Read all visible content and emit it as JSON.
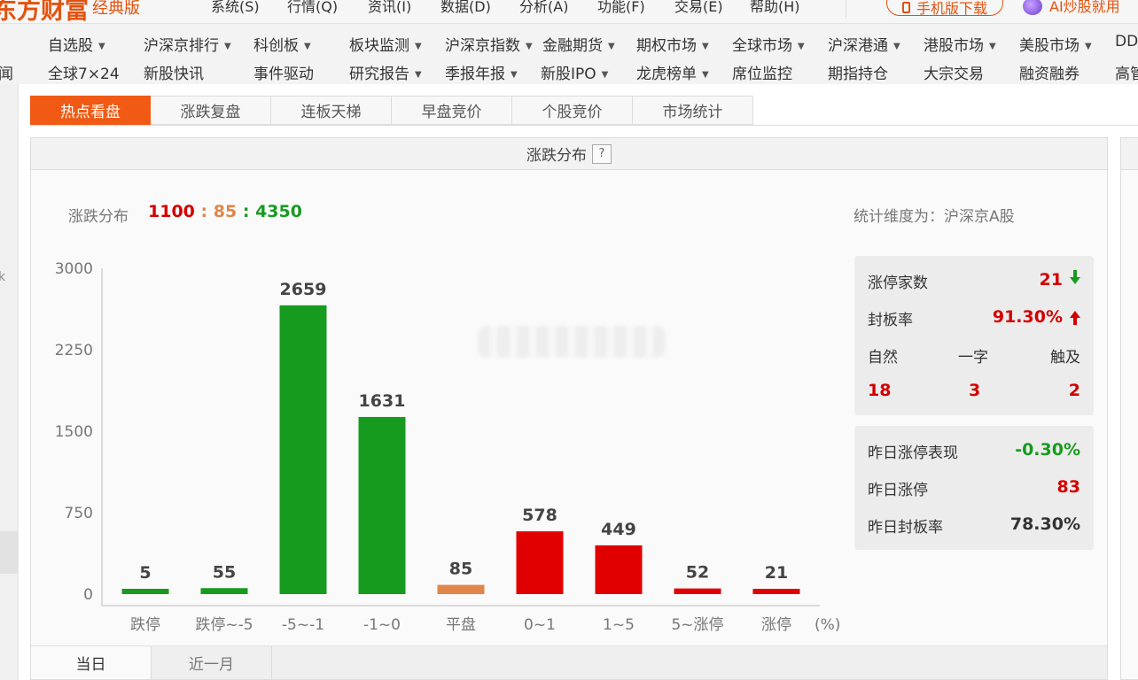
{
  "app": {
    "logo_text": "东方财富",
    "logo_sub": "经典版"
  },
  "menu": {
    "items": [
      "系统(S)",
      "行情(Q)",
      "资讯(I)",
      "数据(D)",
      "分析(A)",
      "功能(F)",
      "交易(E)",
      "帮助(H)"
    ],
    "mobile_download": "手机版下载",
    "ai_stock": "AI炒股就用"
  },
  "nav": {
    "row1": [
      {
        "label": "自选股",
        "dropdown": true
      },
      {
        "label": "沪深京排行",
        "dropdown": true
      },
      {
        "label": "科创板",
        "dropdown": true
      },
      {
        "label": "板块监测",
        "dropdown": true
      },
      {
        "label": "沪深京指数",
        "dropdown": true
      },
      {
        "label": "金融期货",
        "dropdown": true
      },
      {
        "label": "期权市场",
        "dropdown": true
      },
      {
        "label": "全球市场",
        "dropdown": true
      },
      {
        "label": "沪深港通",
        "dropdown": true
      },
      {
        "label": "港股市场",
        "dropdown": true
      },
      {
        "label": "美股市场",
        "dropdown": true
      },
      {
        "label": "DD",
        "dropdown": false
      }
    ],
    "row2": [
      {
        "label": "闻",
        "dropdown": false
      },
      {
        "label": "全球7×24",
        "dropdown": false
      },
      {
        "label": "新股快讯",
        "dropdown": false
      },
      {
        "label": "事件驱动",
        "dropdown": false
      },
      {
        "label": "研究报告",
        "dropdown": true
      },
      {
        "label": "季报年报",
        "dropdown": true
      },
      {
        "label": "新股IPO",
        "dropdown": true
      },
      {
        "label": "龙虎榜单",
        "dropdown": true
      },
      {
        "label": "席位监控",
        "dropdown": false
      },
      {
        "label": "期指持仓",
        "dropdown": false
      },
      {
        "label": "大宗交易",
        "dropdown": false
      },
      {
        "label": "融资融券",
        "dropdown": false
      },
      {
        "label": "高管",
        "dropdown": false
      }
    ]
  },
  "sidebar_mark": "k",
  "subtabs": [
    "热点看盘",
    "涨跌复盘",
    "连板天梯",
    "早盘竞价",
    "个股竞价",
    "市场统计"
  ],
  "panel": {
    "title": "涨跌分布",
    "help": "?",
    "dist_label": "涨跌分布",
    "ratio": {
      "up": "1100",
      "flat": "85",
      "down": "4350",
      "sep": ":"
    },
    "scope": "统计维度为：沪深京A股"
  },
  "chart_data": {
    "type": "bar",
    "categories": [
      "跌停",
      "跌停~-5",
      "-5~-1",
      "-1~0",
      "平盘",
      "0~1",
      "1~5",
      "5~涨停",
      "涨停"
    ],
    "values": [
      5,
      55,
      2659,
      1631,
      85,
      578,
      449,
      52,
      21
    ],
    "colors": [
      "#179b1e",
      "#179b1e",
      "#179b1e",
      "#179b1e",
      "#e0864a",
      "#e00000",
      "#e00000",
      "#e00000",
      "#e00000"
    ],
    "yticks": [
      0,
      750,
      1500,
      2250,
      3000
    ],
    "ylim": [
      0,
      3000
    ],
    "x_unit": "(%)"
  },
  "stats": {
    "limit_up_count_label": "涨停家数",
    "limit_up_count": "21",
    "seal_rate_label": "封板率",
    "seal_rate": "91.30%",
    "types": [
      {
        "label": "自然",
        "value": "18"
      },
      {
        "label": "一字",
        "value": "3"
      },
      {
        "label": "触及",
        "value": "2"
      }
    ],
    "yest_perf_label": "昨日涨停表现",
    "yest_perf": "-0.30%",
    "yest_limit_up_label": "昨日涨停",
    "yest_limit_up": "83",
    "yest_seal_rate_label": "昨日封板率",
    "yest_seal_rate": "78.30%"
  },
  "bottom_tabs": [
    "当日",
    "近一月"
  ],
  "colors": {
    "accent": "#f05a14",
    "up": "#d40000",
    "down": "#179b1e",
    "flat": "#e0864a"
  }
}
